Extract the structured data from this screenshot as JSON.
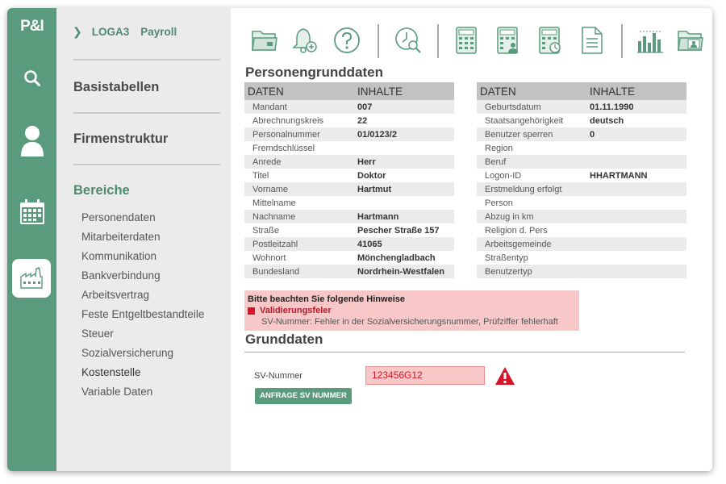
{
  "app": {
    "logo": "P&I"
  },
  "breadcrumb": {
    "module": "LOGA3",
    "area": "Payroll"
  },
  "nav": {
    "sections": [
      "Basistabellen",
      "Firmenstruktur",
      "Bereiche"
    ],
    "items": [
      "Personendaten",
      "Mitarbeiterdaten",
      "Kommunikation",
      "Bankverbindung",
      "Arbeitsvertrag",
      "Feste Entgeltbestandteile",
      "Steuer",
      "Sozialversicherung",
      "Kostenstelle",
      "Variable Daten"
    ]
  },
  "toolbar": {
    "icons": [
      "folder-icon",
      "bell-add-icon",
      "help-icon",
      "clock-search-icon",
      "calculator-icon",
      "calculator-person-icon",
      "calculator-clock-icon",
      "document-icon",
      "bar-chart-icon",
      "folder-person-icon"
    ]
  },
  "personen": {
    "title": "Personengrunddaten",
    "col_head1": "DATEN",
    "col_head2": "INHALTE",
    "left": [
      {
        "label": "Mandant",
        "value": "007"
      },
      {
        "label": "Abrechnungskreis",
        "value": "22"
      },
      {
        "label": "Personalnummer",
        "value": "01/0123/2"
      },
      {
        "label": "Fremdschlüssel",
        "value": ""
      },
      {
        "label": "Anrede",
        "value": "Herr"
      },
      {
        "label": "Titel",
        "value": "Doktor"
      },
      {
        "label": "Vorname",
        "value": "Hartmut"
      },
      {
        "label": "Mittelname",
        "value": ""
      },
      {
        "label": "Nachname",
        "value": "Hartmann"
      },
      {
        "label": "Straße",
        "value": "Pescher Straße 157"
      },
      {
        "label": "Postleitzahl",
        "value": "41065"
      },
      {
        "label": "Wohnort",
        "value": "Mönchengladbach"
      },
      {
        "label": "Bundesland",
        "value": "Nordrhein-Westfalen"
      }
    ],
    "right": [
      {
        "label": "Geburtsdatum",
        "value": "01.11.1990"
      },
      {
        "label": "Staatsangehörigkeit",
        "value": "deutsch"
      },
      {
        "label": "Benutzer sperren",
        "value": "0"
      },
      {
        "label": "Region",
        "value": ""
      },
      {
        "label": "Beruf",
        "value": ""
      },
      {
        "label": "Logon-ID",
        "value": "HHARTMANN"
      },
      {
        "label": "Erstmeldung erfolgt",
        "value": ""
      },
      {
        "label": "Person",
        "value": ""
      },
      {
        "label": "Abzug in km",
        "value": ""
      },
      {
        "label": "Religion d. Pers",
        "value": ""
      },
      {
        "label": "Arbeitsgemeinde",
        "value": ""
      },
      {
        "label": "Straßentyp",
        "value": ""
      },
      {
        "label": "Benutzertyp",
        "value": ""
      }
    ]
  },
  "alert": {
    "title": "Bitte beachten Sie folgende Hinweise",
    "type": "Validierungsfeler",
    "message": "SV-Nummer: Fehler in der Sozialversicherungsnummer, Prüfziffer fehlerhaft"
  },
  "grunddaten": {
    "title": "Grunddaten",
    "sv_label": "SV-Nummer",
    "sv_value": "123456G12",
    "button": "ANFRAGE SV NUMMER"
  },
  "colors": {
    "brand": "#5a9a7d",
    "error": "#d41428",
    "error_bg": "#f8c8c8"
  }
}
